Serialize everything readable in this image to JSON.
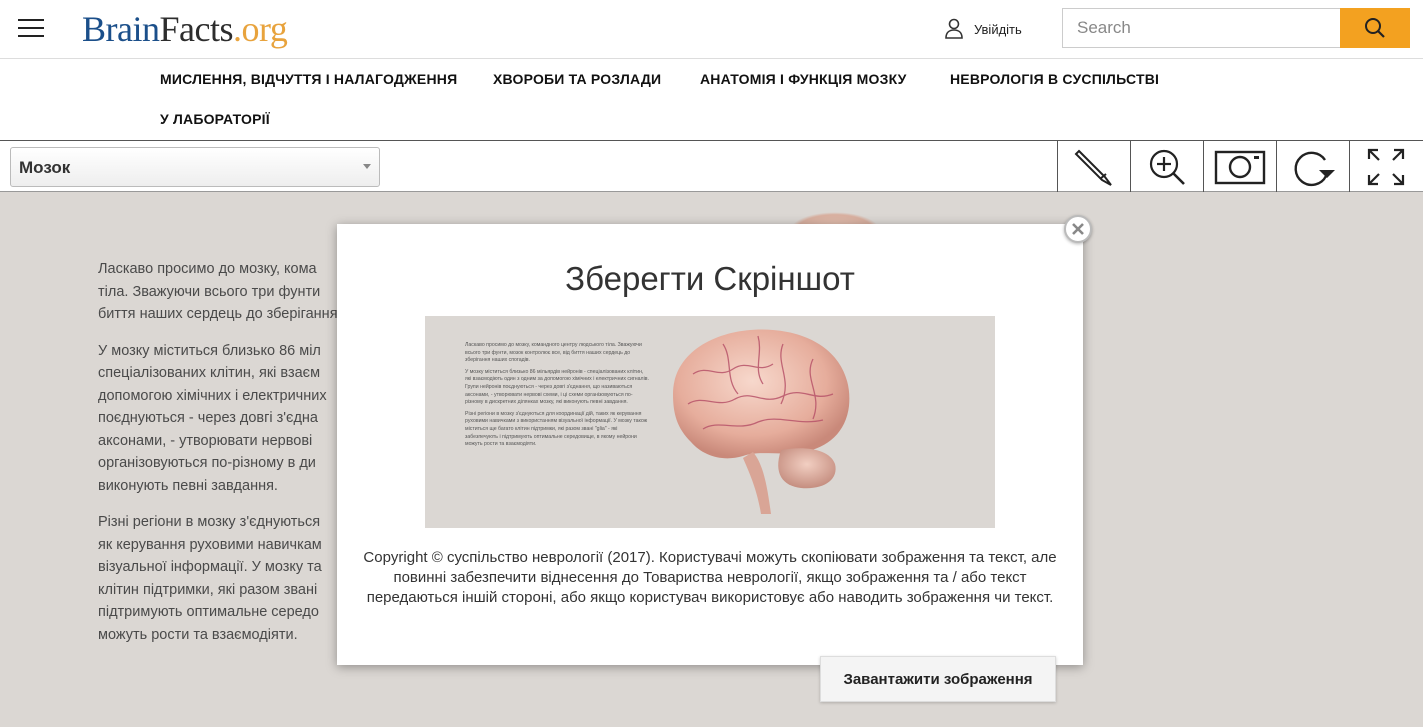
{
  "header": {
    "logo": {
      "brain": "Brain",
      "facts": "Facts",
      "org": ".org"
    },
    "signin_label": "Увійдіть",
    "search_placeholder": "Search"
  },
  "nav": {
    "items": [
      "МИСЛЕННЯ, ВІДЧУТТЯ І НАЛАГОДЖЕННЯ",
      "ХВОРОБИ ТА РОЗЛАДИ",
      "АНАТОМІЯ І ФУНКЦІЯ МОЗКУ",
      "НЕВРОЛОГІЯ В СУСПІЛЬСТВІ",
      "У ЛАБОРАТОРІЇ"
    ]
  },
  "toolbar": {
    "select_value": "Мозок",
    "tools": [
      "pencil-icon",
      "zoom-in-icon",
      "camera-icon",
      "rotate-icon",
      "fullscreen-icon"
    ]
  },
  "content": {
    "paragraphs": [
      "Ласкаво просимо до мозку, кома",
      "тіла. Зважуючи всього три фунти",
      "биття наших сердець до зберігання",
      "У мозку міститься близько 86 міл",
      "спеціалізованих клітин, які взаєм",
      "допомогою хімічних і електричних",
      "поєднуються - через довгі з'єдна",
      "аксонами, - утворювати нервові",
      "організовуються по-різному в ди",
      "виконують певні завдання.",
      "Різні регіони в мозку з'єднуються",
      "як керування руховими навичкам",
      "візуальної інформації. У мозку та",
      "клітин підтримки, які разом звані",
      "підтримують оптимальне середо",
      "можуть рости та взаємодіяти."
    ]
  },
  "modal": {
    "title": "Зберегти Скріншот",
    "preview_text": [
      "Ласкаво просимо до мозку, командного центру людського тіла. Зважуючи всього три фунти, мозок контролює все, від биття наших сердець до зберігання наших спогадів.",
      "У мозку міститься близько 86 мільярдів нейронів - спеціалізованих клітин, які взаємодіють один з одним за допомогою хімічних і електричних сигналів. Групи нейронів поєднуються - через довгі з'єднання, що називаються аксонами, - утворювати нервові схеми, і ці схеми організовуються по-різному в дискретних ділянках мозку, які виконують певні завдання.",
      "Різні регіони в мозку з'єднуються для координації дій, таких як керування руховими навичками з використанням візуальної інформації. У мозку також міститься ще багато клітин підтримки, які разом звані \"glia\" - які забезпечують і підтримують оптимальне середовище, в якому нейрони можуть рости та взаємодіяти."
    ],
    "copyright": "Copyright © суспільство неврології (2017). Користувачі можуть скопіювати зображення та текст, але повинні забезпечити віднесення до Товариства неврології, якщо зображення та / або текст передаються іншій стороні, або якщо користувач використовує або наводить зображення чи текст.",
    "download_label": "Завантажити зображення"
  },
  "colors": {
    "accent": "#f3a120",
    "logo_blue": "#1b4f8a",
    "logo_orange": "#e8a33d",
    "backdrop": "#dbd7d3"
  }
}
